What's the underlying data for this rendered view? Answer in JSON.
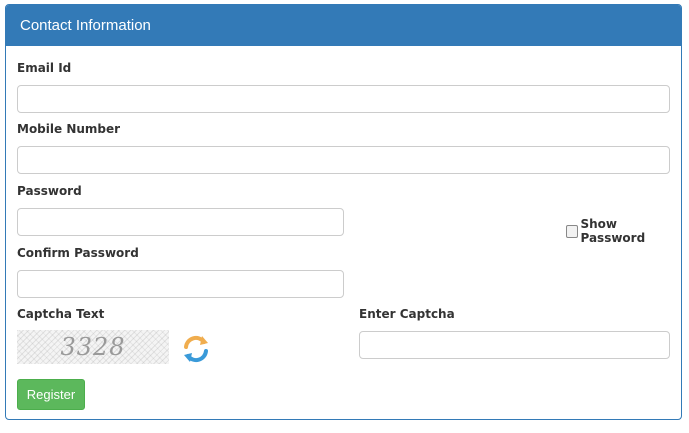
{
  "panel": {
    "title": "Contact Information"
  },
  "form": {
    "email_label": "Email Id",
    "email_value": "",
    "mobile_label": "Mobile Number",
    "mobile_value": "",
    "password_label": "Password",
    "password_value": "",
    "show_password_label": "Show Password",
    "show_password_checked": false,
    "confirm_password_label": "Confirm Password",
    "confirm_password_value": "",
    "captcha_text_label": "Captcha Text",
    "captcha_image_text": "3328",
    "enter_captcha_label": "Enter Captcha",
    "enter_captcha_value": "",
    "register_label": "Register"
  },
  "icons": {
    "refresh": "refresh-icon"
  },
  "colors": {
    "panel_header": "#337ab7",
    "register_button": "#5cb85c",
    "refresh_orange": "#f0ad4e",
    "refresh_blue": "#3a9ad9"
  }
}
